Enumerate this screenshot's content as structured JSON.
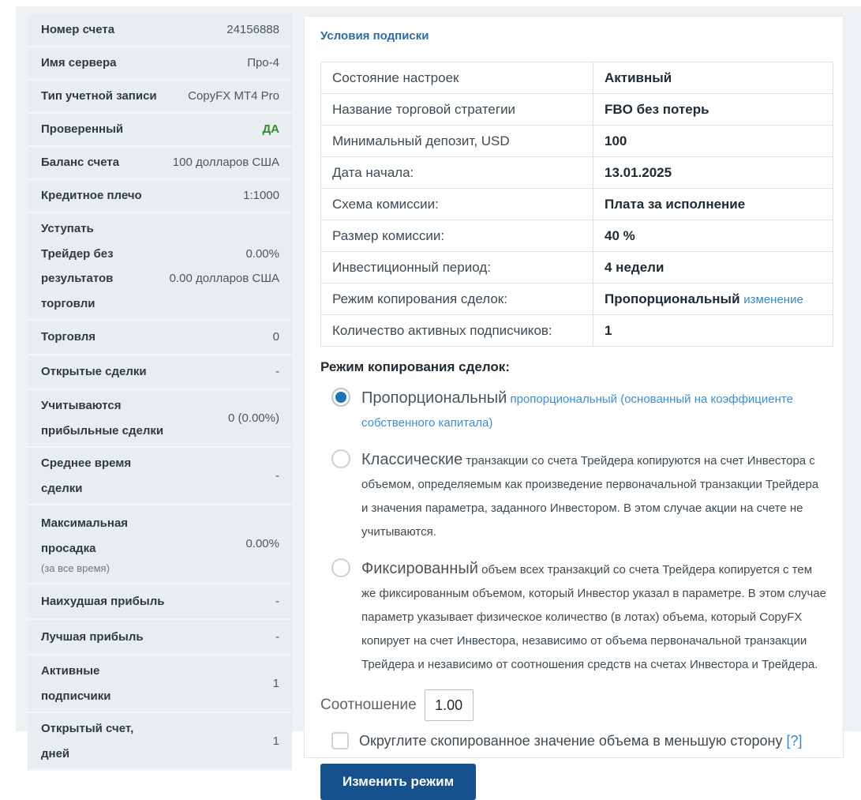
{
  "colors": {
    "accent_blue": "#2e6ca3",
    "link_blue": "#3a87c8",
    "status_green": "#2e8b2e",
    "button_blue": "#16508d",
    "radio_selected": "#1f72b5",
    "sidebar_row_bg": "#e8eef0"
  },
  "sidebar": {
    "rows": [
      {
        "label": "Номер счета",
        "value": "24156888"
      },
      {
        "label": "Имя сервера",
        "value": "Про-4"
      },
      {
        "label": "Тип учетной записи",
        "value": "CopyFX MT4 Pro"
      },
      {
        "label": "Проверенный",
        "value": "ДА"
      },
      {
        "label": "Баланс счета",
        "value": "100 долларов США"
      },
      {
        "label": "Кредитное плечо",
        "value": "1:1000"
      },
      {
        "label": "Уступать Трейдер без результатов торговли",
        "value": "0.00%",
        "value2": "0.00 долларов США"
      },
      {
        "label": "Торговля",
        "value": "0"
      },
      {
        "label": "Открытые сделки",
        "value": "-"
      },
      {
        "label": "Учитываются прибыльные сделки",
        "value": "0 (0.00%)"
      },
      {
        "label": "Среднее время сделки",
        "value": "-"
      },
      {
        "label": "Максимальная просадка",
        "note": "(за все время)",
        "value": "0.00%"
      },
      {
        "label": "Наихудшая прибыль",
        "value": "-"
      },
      {
        "label": "Лучшая прибыль",
        "value": "-"
      },
      {
        "label": "Активные подписчики",
        "value": "1"
      },
      {
        "label": "Открытый счет, дней",
        "value": "1"
      }
    ]
  },
  "main": {
    "heading": "Условия подписки",
    "table": {
      "rows": [
        {
          "label": "Состояние настроек",
          "value": "Активный"
        },
        {
          "label": "Название торговой стратегии",
          "value": "FBO без потерь"
        },
        {
          "label": "Минимальный депозит, USD",
          "value": "100"
        },
        {
          "label": "Дата начала:",
          "value": "13.01.2025"
        },
        {
          "label": "Схема комиссии:",
          "value": "Плата за исполнение"
        },
        {
          "label": "Размер комиссии:",
          "value": "40 %"
        },
        {
          "label": "Инвестиционный период:",
          "value": "4 недели"
        },
        {
          "label": "Режим копирования сделок:",
          "value": "Пропорциональный",
          "link": "изменение"
        },
        {
          "label": "Количество активных подписчиков:",
          "value": "1"
        }
      ]
    },
    "copy_mode": {
      "heading": "Режим копирования сделок:",
      "options": [
        {
          "name": "Пропорциональный",
          "description": "пропорциональный (основанный на коэффициенте собственного капитала)",
          "selected": true
        },
        {
          "name": "Классические",
          "description": "транзакции со счета Трейдера копируются на счет Инвестора с объемом, определяемым как произведение первоначальной транзакции Трейдера и значения параметра, заданного Инвестором. В этом случае акции на счете не учитываются.",
          "selected": false
        },
        {
          "name": "Фиксированный",
          "description": "объем всех транзакций со счета Трейдера копируется с тем же фиксированным объемом, который Инвестор указал в параметре. В этом случае параметр указывает физическое количество (в лотах) объема, который CopyFX копирует на счет Инвестора, независимо от объема первоначальной транзакции Трейдера и независимо от соотношения средств на счетах Инвестора и Трейдера.",
          "selected": false
        }
      ]
    },
    "ratio": {
      "label": "Соотношение",
      "value": "1.00"
    },
    "round_option": {
      "label": "Округлите скопированное значение объема в меньшую сторону",
      "help": "[?]",
      "checked": false
    },
    "submit_label": "Изменить режим"
  }
}
